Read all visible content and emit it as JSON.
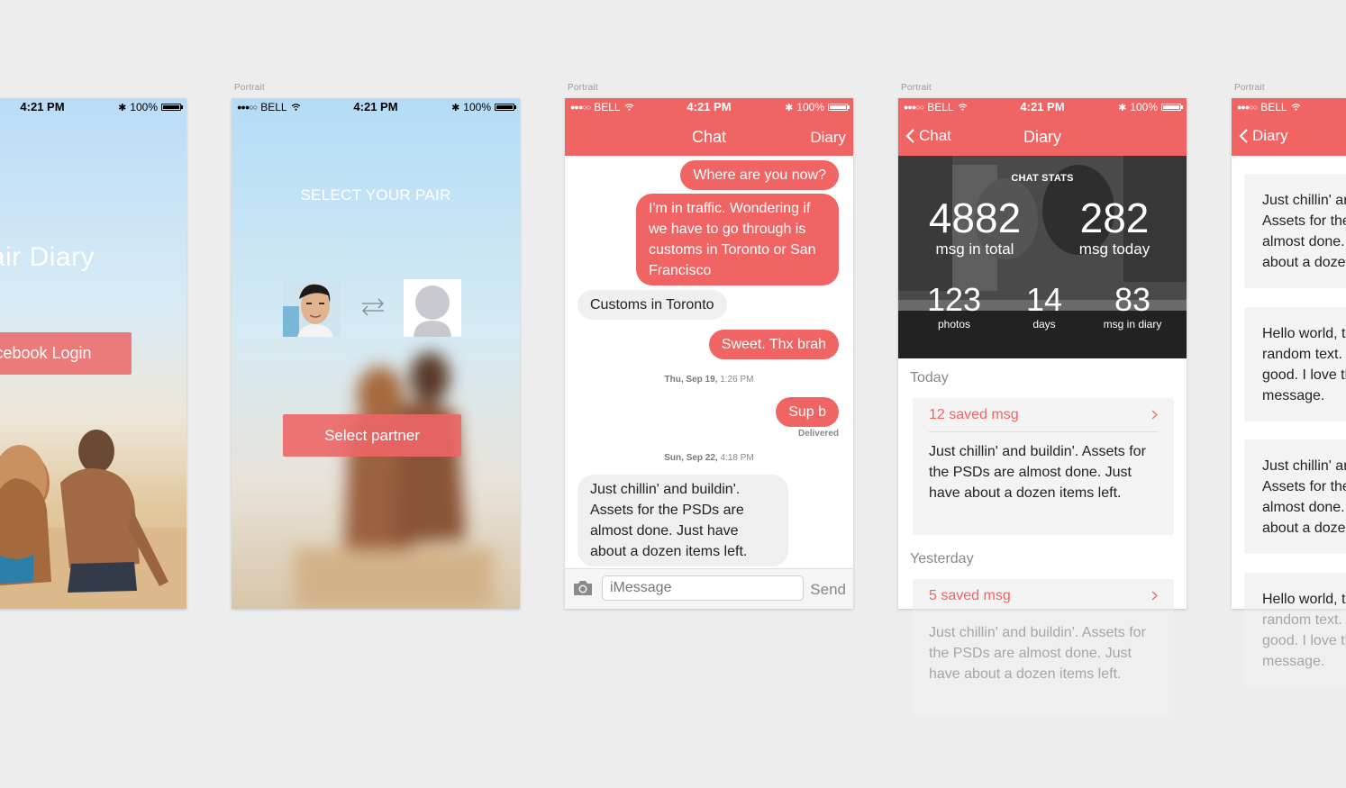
{
  "artboard_label": "Portrait",
  "status": {
    "carrier": "BELL",
    "time": "4:21 PM",
    "battery": "100%"
  },
  "screen1": {
    "app_title": "air Diary",
    "login_button": "cebook Login"
  },
  "screen2": {
    "title": "SELECT YOUR PAIR",
    "select_button": "Select partner"
  },
  "chat": {
    "nav_title": "Chat",
    "nav_right": "Diary",
    "messages": [
      "Where are you now?",
      "I'm in traffic. Wondering if we have to go through is customs in Toronto or San Francisco",
      "Customs in Toronto",
      "Sweet. Thx brah",
      "Sup b",
      "Just chillin' and buildin'. Assets for the PSDs are almost done. Just have about a dozen items left."
    ],
    "timestamp1_day": "Thu, Sep 19,",
    "timestamp1_time": "1:26 PM",
    "delivered": "Delivered",
    "timestamp2_day": "Sun, Sep 22,",
    "timestamp2_time": "4:18 PM",
    "input_placeholder": "iMessage",
    "send": "Send"
  },
  "diary": {
    "back_label": "Chat",
    "nav_title": "Diary",
    "stats_title": "CHAT STATS",
    "stats": {
      "total": "4882",
      "total_label": "msg in total",
      "today": "282",
      "today_label": "msg today",
      "photos": "123",
      "photos_label": "photos",
      "days": "14",
      "days_label": "days",
      "diary": "83",
      "diary_label": "msg in diary"
    },
    "sections": [
      {
        "heading": "Today",
        "card_title": "12 saved msg",
        "card_body": "Just chillin' and buildin'. Assets for the PSDs are almost done. Just have about a dozen items left."
      },
      {
        "heading": "Yesterday",
        "card_title": "5 saved msg",
        "card_body": "Just chillin' and buildin'. Assets for the PSDs are almost done. Just have about a dozen items left."
      }
    ]
  },
  "screen5": {
    "back_label": "Diary",
    "notes": [
      "Just chillin' and buildin'. Assets for the PSDs are almost done. Just have about a dozen items left.",
      "Hello world, this is some random text. It looks good. I love this message.",
      "Just chillin' and buildin'. Assets for the PSDs are almost done. Just have about a dozen items left.",
      "Hello world, this is some random text. It looks good. I love this message."
    ]
  },
  "colors": {
    "accent": "#f06464",
    "canvas": "#ededed",
    "incoming_bubble": "#efefef"
  }
}
